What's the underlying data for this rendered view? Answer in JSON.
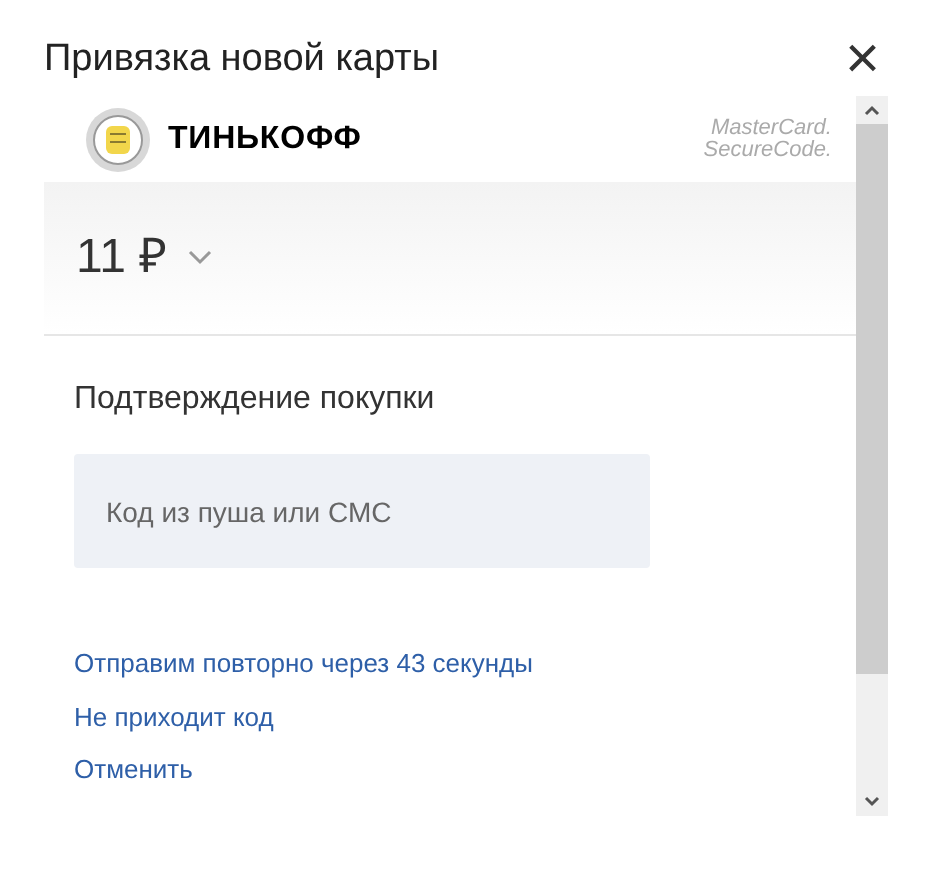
{
  "dialog": {
    "title": "Привязка новой карты",
    "close": "×"
  },
  "bank": {
    "name": "ТИНЬКОФФ",
    "secure_code": [
      "MasterCard.",
      "SecureCode."
    ]
  },
  "amount": {
    "value": "11 ₽"
  },
  "form": {
    "heading": "Подтверждение покупки",
    "code_field": {
      "placeholder": "Код из пуша или СМС"
    }
  },
  "links": [
    {
      "text": "Отправим повторно через 43 секунды"
    },
    {
      "text": "Не приходит код"
    },
    {
      "text": "Отменить"
    }
  ]
}
